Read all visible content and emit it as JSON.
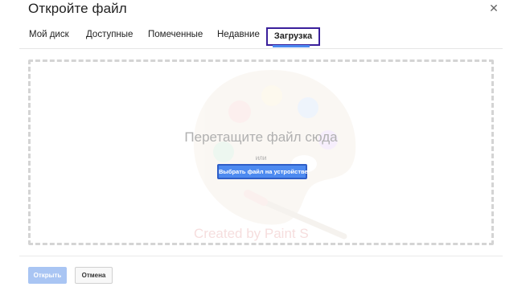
{
  "dialog": {
    "title": "Откройте файл",
    "close_icon": "close-icon"
  },
  "tabs": [
    {
      "label": "Мой диск",
      "active": false
    },
    {
      "label": "Доступные",
      "active": false
    },
    {
      "label": "Помеченные",
      "active": false
    },
    {
      "label": "Недавние",
      "active": false
    },
    {
      "label": "Загрузка",
      "active": true
    }
  ],
  "dropzone": {
    "drop_text": "Перетащите файл сюда",
    "or_text": "или",
    "choose_button_label": "Выбрать файл на устройстве",
    "background_art": "paint-palette-icon",
    "watermark": "Created by Paint S"
  },
  "footer": {
    "open_label": "Открыть",
    "cancel_label": "Отмена"
  },
  "colors": {
    "accent": "#4d8af0",
    "active_tab_outline": "#3a1f9b",
    "open_disabled": "#a9c5f3",
    "dashed_border": "#d4d4d4"
  }
}
